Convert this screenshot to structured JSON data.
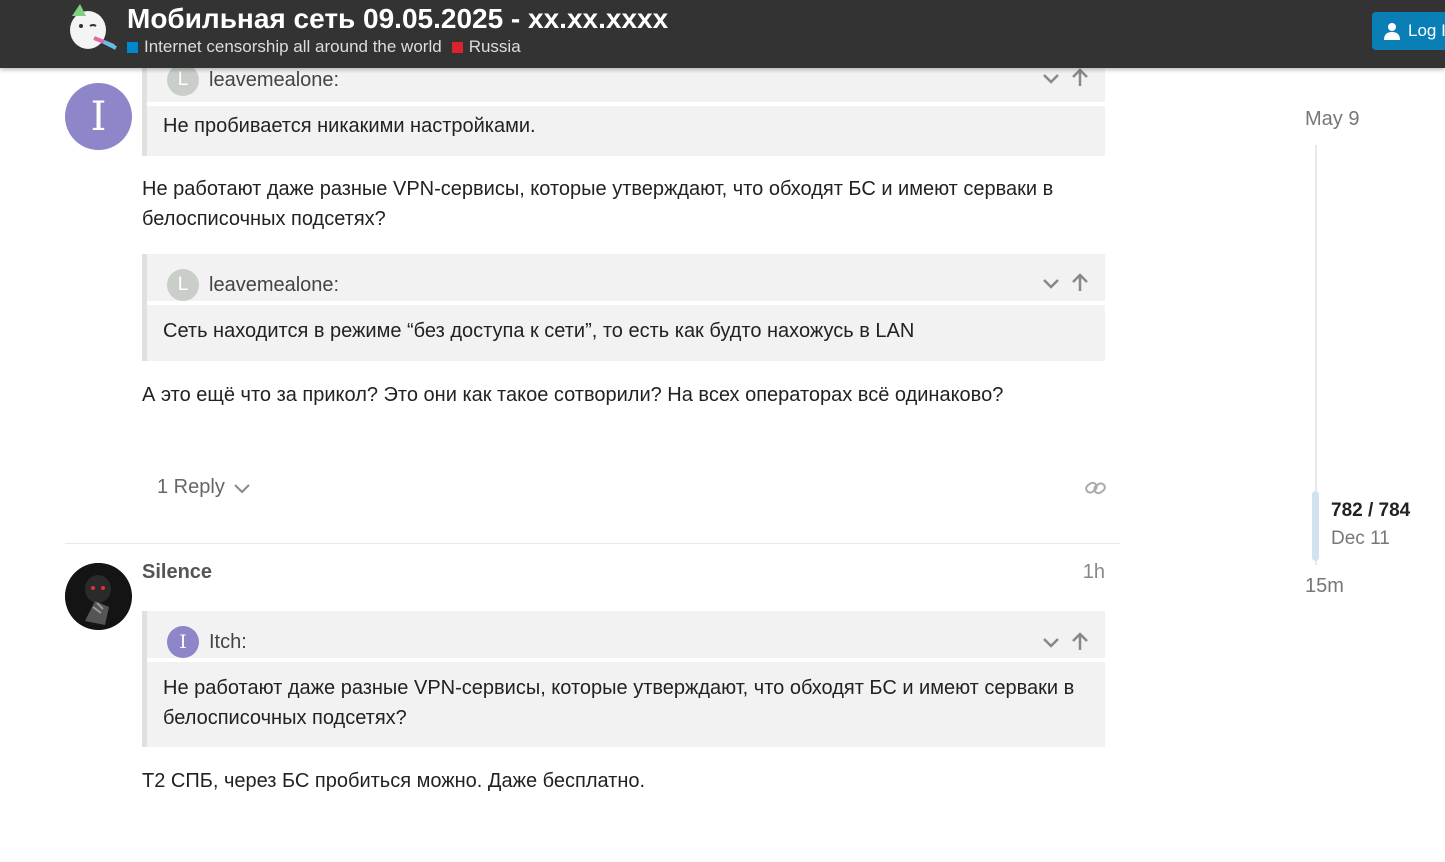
{
  "header": {
    "title": "Мобильная сеть 09.05.2025 - xx.xx.xxxx",
    "categories": [
      {
        "name": "Internet censorship all around the world",
        "color": "#0088cc"
      },
      {
        "name": "Russia",
        "color": "#d9232e"
      }
    ],
    "login_label": "Log In"
  },
  "post1": {
    "avatar_letter": "I",
    "quote1": {
      "avatar_letter": "L",
      "author": "leavemealone:",
      "text": "Не пробивается никакими настройками."
    },
    "text1_line1": "Не работают даже разные VPN-сервисы, которые утверждают, что обходят БС и имеют серваки в",
    "text1_line2": "белосписочных подсетях?",
    "quote2": {
      "avatar_letter": "L",
      "author": "leavemealone:",
      "text": "Сеть находится в режиме “без доступа к сети”, то есть как будто нахожусь в LAN"
    },
    "text2": "А это ещё что за прикол? Это они как такое сотворили? На всех операторах всё одинаково?",
    "replies_label": "1 Reply"
  },
  "post2": {
    "username": "Silence",
    "time": "1h",
    "quote": {
      "avatar_letter": "I",
      "author": "Itch:",
      "line1": "Не работают даже разные VPN-сервисы, которые утверждают, что обходят БС и имеют серваки в",
      "line2": "белосписочных подсетях?"
    },
    "text": "Т2 СПБ, через БС пробиться можно. Даже бесплатно."
  },
  "timeline": {
    "top_date": "May 9",
    "position": "782 / 784",
    "current_date": "Dec 11",
    "bottom_label": "15m"
  }
}
